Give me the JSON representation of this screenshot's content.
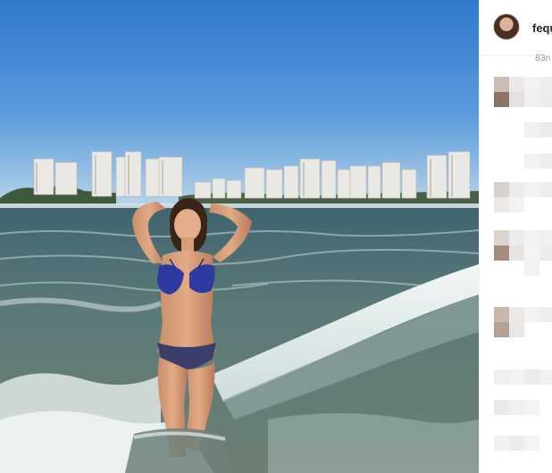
{
  "post": {
    "username": "fequ",
    "timestamp": "83n"
  },
  "icons": {
    "avatar": "profile-avatar"
  },
  "colors": {
    "sky_top": "#3a7fd0",
    "sky_bottom": "#a9cbe8",
    "sea": "#4f6a6a",
    "foam": "#e8eef0",
    "bikini": "#2d3aa0",
    "panel_border": "#efefef",
    "username": "#262626",
    "timestamp": "#8e8e8e"
  },
  "comments": [
    {
      "blurred": true
    },
    {
      "blurred": true
    },
    {
      "blurred": true
    },
    {
      "blurred": true
    },
    {
      "blurred": true
    },
    {
      "blurred": true
    },
    {
      "blurred": true
    }
  ]
}
